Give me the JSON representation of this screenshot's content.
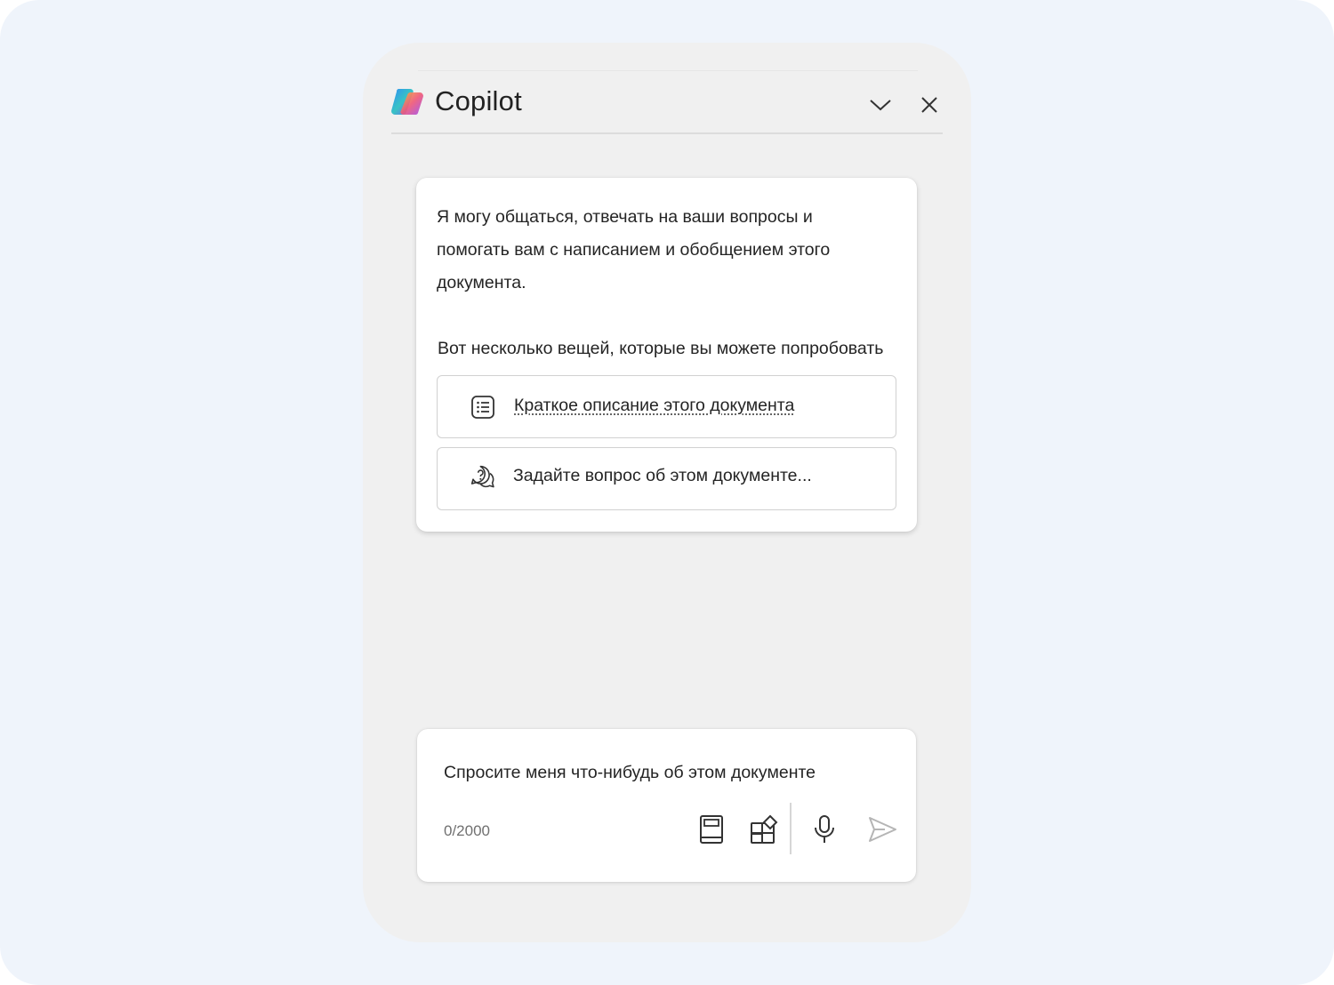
{
  "header": {
    "title": "Copilot",
    "logo_icon": "copilot-logo-icon",
    "collapse_icon": "chevron-down-icon",
    "close_icon": "close-icon"
  },
  "card": {
    "intro_text": "Я могу общаться, отвечать на ваши вопросы и помогать вам с написанием и обобщением этого документа.",
    "try_label": "Вот несколько вещей, которые вы можете попробовать",
    "suggestions": [
      {
        "label": "Краткое описание этого документа",
        "icon": "list-icon"
      },
      {
        "label": "Задайте вопрос об этом документе...",
        "icon": "question-chat-icon"
      }
    ]
  },
  "composer": {
    "placeholder": "Спросите меня что-нибудь об этом документе",
    "counter": "0/2000",
    "tools": [
      "notebook-icon",
      "apps-add-icon",
      "microphone-icon",
      "send-icon"
    ]
  },
  "colors": {
    "page_bg": "#eff4fb",
    "panel_bg": "#f0f0f0",
    "card_bg": "#ffffff",
    "text": "#242424"
  }
}
